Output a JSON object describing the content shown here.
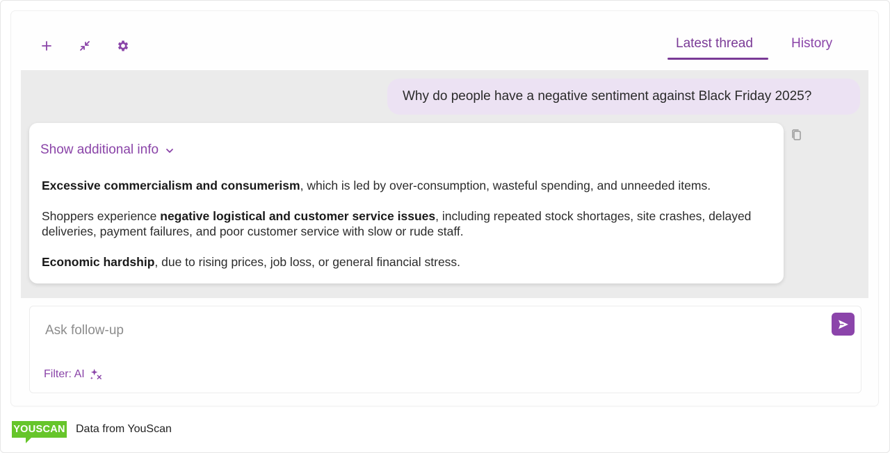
{
  "toolbar": {
    "new_icon": "plus-icon",
    "collapse_icon": "collapse-icon",
    "settings_icon": "gear-icon"
  },
  "tabs": [
    {
      "label": "Latest thread",
      "active": true
    },
    {
      "label": "History",
      "active": false
    }
  ],
  "thread": {
    "user_message": "Why do people have a negative sentiment against Black Friday 2025?",
    "answer": {
      "show_info_label": "Show additional info",
      "paragraphs": [
        {
          "bold": "Excessive commercialism and consumerism",
          "pre": "",
          "rest": ", which is led by over-consumption, wasteful spending, and unneeded items."
        },
        {
          "pre": "Shoppers experience ",
          "bold": "negative logistical and customer service issues",
          "rest": ", including repeated stock shortages, site crashes, delayed deliveries, payment failures, and poor customer service with slow or rude staff."
        },
        {
          "bold": "Economic hardship",
          "pre": "",
          "rest": ", due to rising prices, job loss, or general financial stress."
        }
      ]
    }
  },
  "composer": {
    "placeholder": "Ask follow-up",
    "value": "",
    "filter_label": "Filter: AI"
  },
  "footer": {
    "logo_text": "YOUSCAN",
    "text": "Data from YouScan"
  },
  "colors": {
    "accent": "#8a44a8",
    "user_bubble": "#ece2f3",
    "thread_bg": "#ebebeb",
    "brand_green": "#66c52a"
  }
}
